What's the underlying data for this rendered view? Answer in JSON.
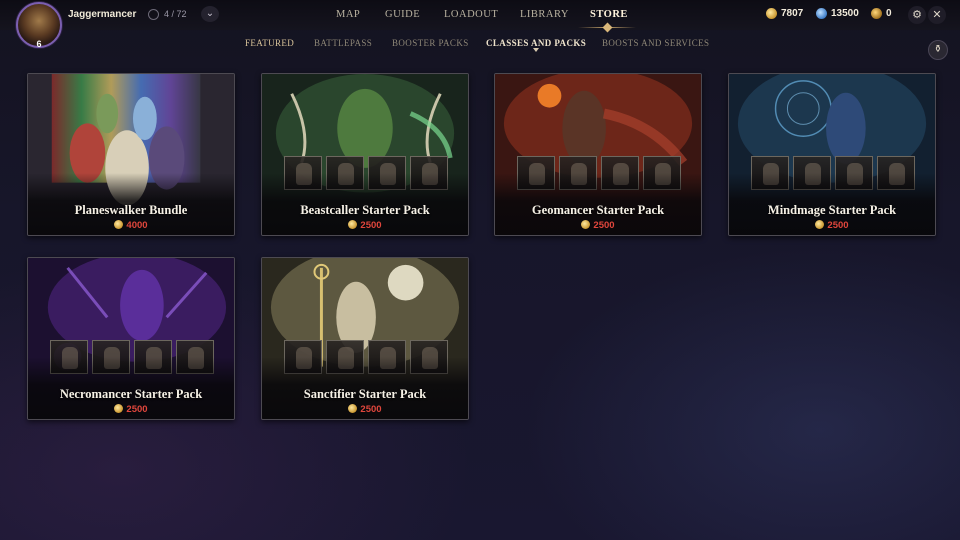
{
  "header": {
    "username": "Jaggermancer",
    "level": "6",
    "rank_text": "4 / 72",
    "nav": [
      {
        "label": "MAP"
      },
      {
        "label": "GUIDE"
      },
      {
        "label": "LOADOUT"
      },
      {
        "label": "LIBRARY"
      },
      {
        "label": "STORE",
        "active": true
      }
    ],
    "currencies": [
      {
        "icon": "gold-coin-icon",
        "value": "7807"
      },
      {
        "icon": "blue-gem-icon",
        "value": "13500"
      },
      {
        "icon": "token-icon",
        "value": "0"
      }
    ],
    "icons": [
      "settings-gear-icon",
      "close-icon",
      "chevron-down-icon",
      "rank-icon"
    ]
  },
  "subtabs": [
    {
      "label": "FEATURED"
    },
    {
      "label": "BATTLEPASS"
    },
    {
      "label": "BOOSTER PACKS"
    },
    {
      "label": "CLASSES AND PACKS",
      "active": true
    },
    {
      "label": "BOOSTS AND SERVICES"
    }
  ],
  "cards": [
    {
      "title": "Planeswalker Bundle",
      "price": "4000"
    },
    {
      "title": "Beastcaller Starter Pack",
      "price": "2500"
    },
    {
      "title": "Geomancer Starter Pack",
      "price": "2500"
    },
    {
      "title": "Mindmage Starter Pack",
      "price": "2500"
    },
    {
      "title": "Necromancer Starter Pack",
      "price": "2500"
    },
    {
      "title": "Sanctifier Starter Pack",
      "price": "2500"
    }
  ],
  "colors": {
    "price_red": "#e0463c",
    "store_accent": "#d9b77a",
    "avatar_ring": "#7b5fb0"
  }
}
